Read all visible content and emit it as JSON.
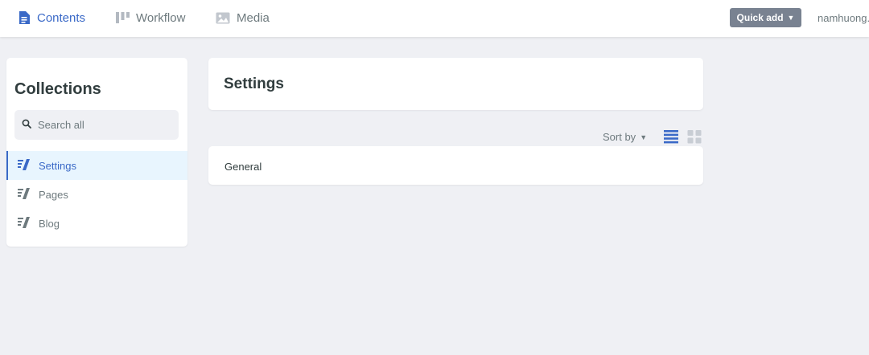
{
  "nav": {
    "items": [
      {
        "label": "Contents",
        "icon": "document-icon",
        "active": true
      },
      {
        "label": "Workflow",
        "icon": "workflow-icon",
        "active": false
      },
      {
        "label": "Media",
        "icon": "image-icon",
        "active": false
      }
    ],
    "quick_add_label": "Quick add",
    "user_name": "namhuong."
  },
  "sidebar": {
    "title": "Collections",
    "search_placeholder": "Search all",
    "collections": [
      {
        "label": "Settings",
        "icon": "collection-icon",
        "active": true
      },
      {
        "label": "Pages",
        "icon": "collection-icon",
        "active": false
      },
      {
        "label": "Blog",
        "icon": "collection-icon",
        "active": false
      }
    ]
  },
  "main": {
    "title": "Settings",
    "sort_label": "Sort by",
    "view_modes": [
      "list-view-icon",
      "grid-view-icon"
    ],
    "active_view": "list",
    "entries": [
      {
        "title": "General"
      }
    ]
  },
  "colors": {
    "accent": "#3a69c7",
    "active_background": "#e8f5fe",
    "page_background": "#eff0f4",
    "button_background": "#798291",
    "text_muted": "#6e7a7e",
    "text_dark": "#313d3e"
  }
}
